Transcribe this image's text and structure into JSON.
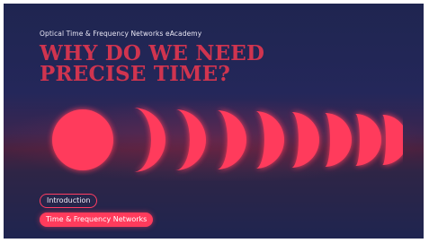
{
  "header": {
    "kicker": "Optical Time & Frequency Networks eAcademy",
    "title_line1": "WHY DO WE NEED",
    "title_line2": "PRECISE TIME?"
  },
  "graphic": {
    "icon": "moon-phases-icon",
    "accent_color": "#ff3b5c"
  },
  "chapters": [
    {
      "label": "Introduction",
      "state": "outlined"
    },
    {
      "label": "Time & Frequency Networks",
      "state": "selected"
    }
  ],
  "colors": {
    "background": "#1f2550",
    "accent": "#ff3b5c",
    "title": "#d0344f"
  }
}
